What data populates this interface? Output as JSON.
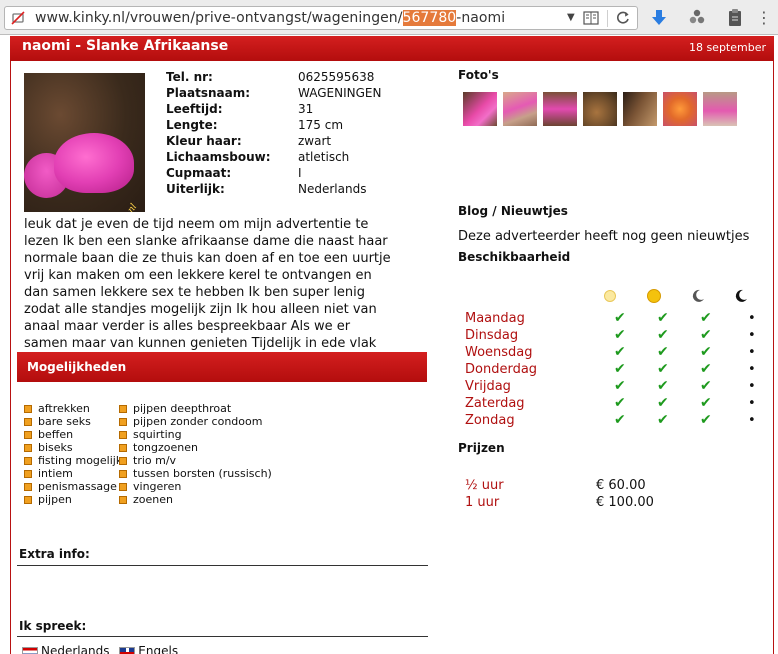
{
  "browser": {
    "url_prefix": "www.kinky.nl/vrouwen/prive-ontvangst/wageningen/",
    "url_highlight": "567780",
    "url_suffix": "-naomi"
  },
  "profile": {
    "title": "naomi - Slanke Afrikaanse",
    "date": "18 september",
    "photo_watermark": "Kinky.nl",
    "details": [
      {
        "label": "Tel. nr:",
        "value": "0625595638"
      },
      {
        "label": "Plaatsnaam:",
        "value": "WAGENINGEN"
      },
      {
        "label": "Leeftijd:",
        "value": "31"
      },
      {
        "label": "Lengte:",
        "value": "175 cm"
      },
      {
        "label": "Kleur haar:",
        "value": "zwart"
      },
      {
        "label": "Lichaamsbouw:",
        "value": "atletisch"
      },
      {
        "label": "Cupmaat:",
        "value": "I"
      },
      {
        "label": "Uiterlijk:",
        "value": "Nederlands"
      }
    ],
    "about": "leuk dat je even de tijd neem om mijn advertentie te lezen Ik ben een slanke afrikaanse dame die naast haar normale baan die ze thuis kan doen af en toe een uurtje vrij kan maken om een lekkere kerel te ontvangen en dan samen lekkere sex te hebben Ik ben super lenig zodat alle standjes mogelijk zijn Ik hou alleen niet van anaal maar verder is alles bespreekbaar Als we er samen maar van kunnen genieten Tijdelijk in ede vlak bij ziekenhuis"
  },
  "mogelijkheden": {
    "heading": "Mogelijkheden",
    "col1": [
      "aftrekken",
      "bare seks",
      "beffen",
      "biseks",
      "fisting mogelijk",
      "intiem",
      "penismassage",
      "pijpen"
    ],
    "col2": [
      "pijpen deepthroat",
      "pijpen zonder condoom",
      "squirting",
      "tongzoenen",
      "trio m/v",
      "tussen borsten (russisch)",
      "vingeren",
      "zoenen"
    ]
  },
  "extra_info": {
    "heading": "Extra info:"
  },
  "languages": {
    "heading": "Ik spreek:",
    "items": [
      "Nederlands",
      "Engels"
    ]
  },
  "right": {
    "photos_heading": "Foto's",
    "blog_heading": "Blog / Nieuwtjes",
    "blog_text": "Deze adverteerder heeft nog geen nieuwtjes",
    "avail_heading": "Beschikbaarheid",
    "days": [
      "Maandag",
      "Dinsdag",
      "Woensdag",
      "Donderdag",
      "Vrijdag",
      "Zaterdag",
      "Zondag"
    ],
    "period_icons": [
      "sunrise-icon",
      "sun-icon",
      "moon-icon",
      "night-moon-icon"
    ],
    "availability": [
      [
        "check",
        "check",
        "check",
        "dot"
      ],
      [
        "check",
        "check",
        "check",
        "dot"
      ],
      [
        "check",
        "check",
        "check",
        "dot"
      ],
      [
        "check",
        "check",
        "check",
        "dot"
      ],
      [
        "check",
        "check",
        "check",
        "dot"
      ],
      [
        "check",
        "check",
        "check",
        "dot"
      ],
      [
        "check",
        "check",
        "check",
        "dot"
      ]
    ],
    "check_glyph": "✔",
    "dot_glyph": "•",
    "prices_heading": "Prijzen",
    "prices": [
      {
        "duration": "½   uur",
        "price": "€ 60.00"
      },
      {
        "duration": "1   uur",
        "price": "€ 100.00"
      }
    ]
  }
}
